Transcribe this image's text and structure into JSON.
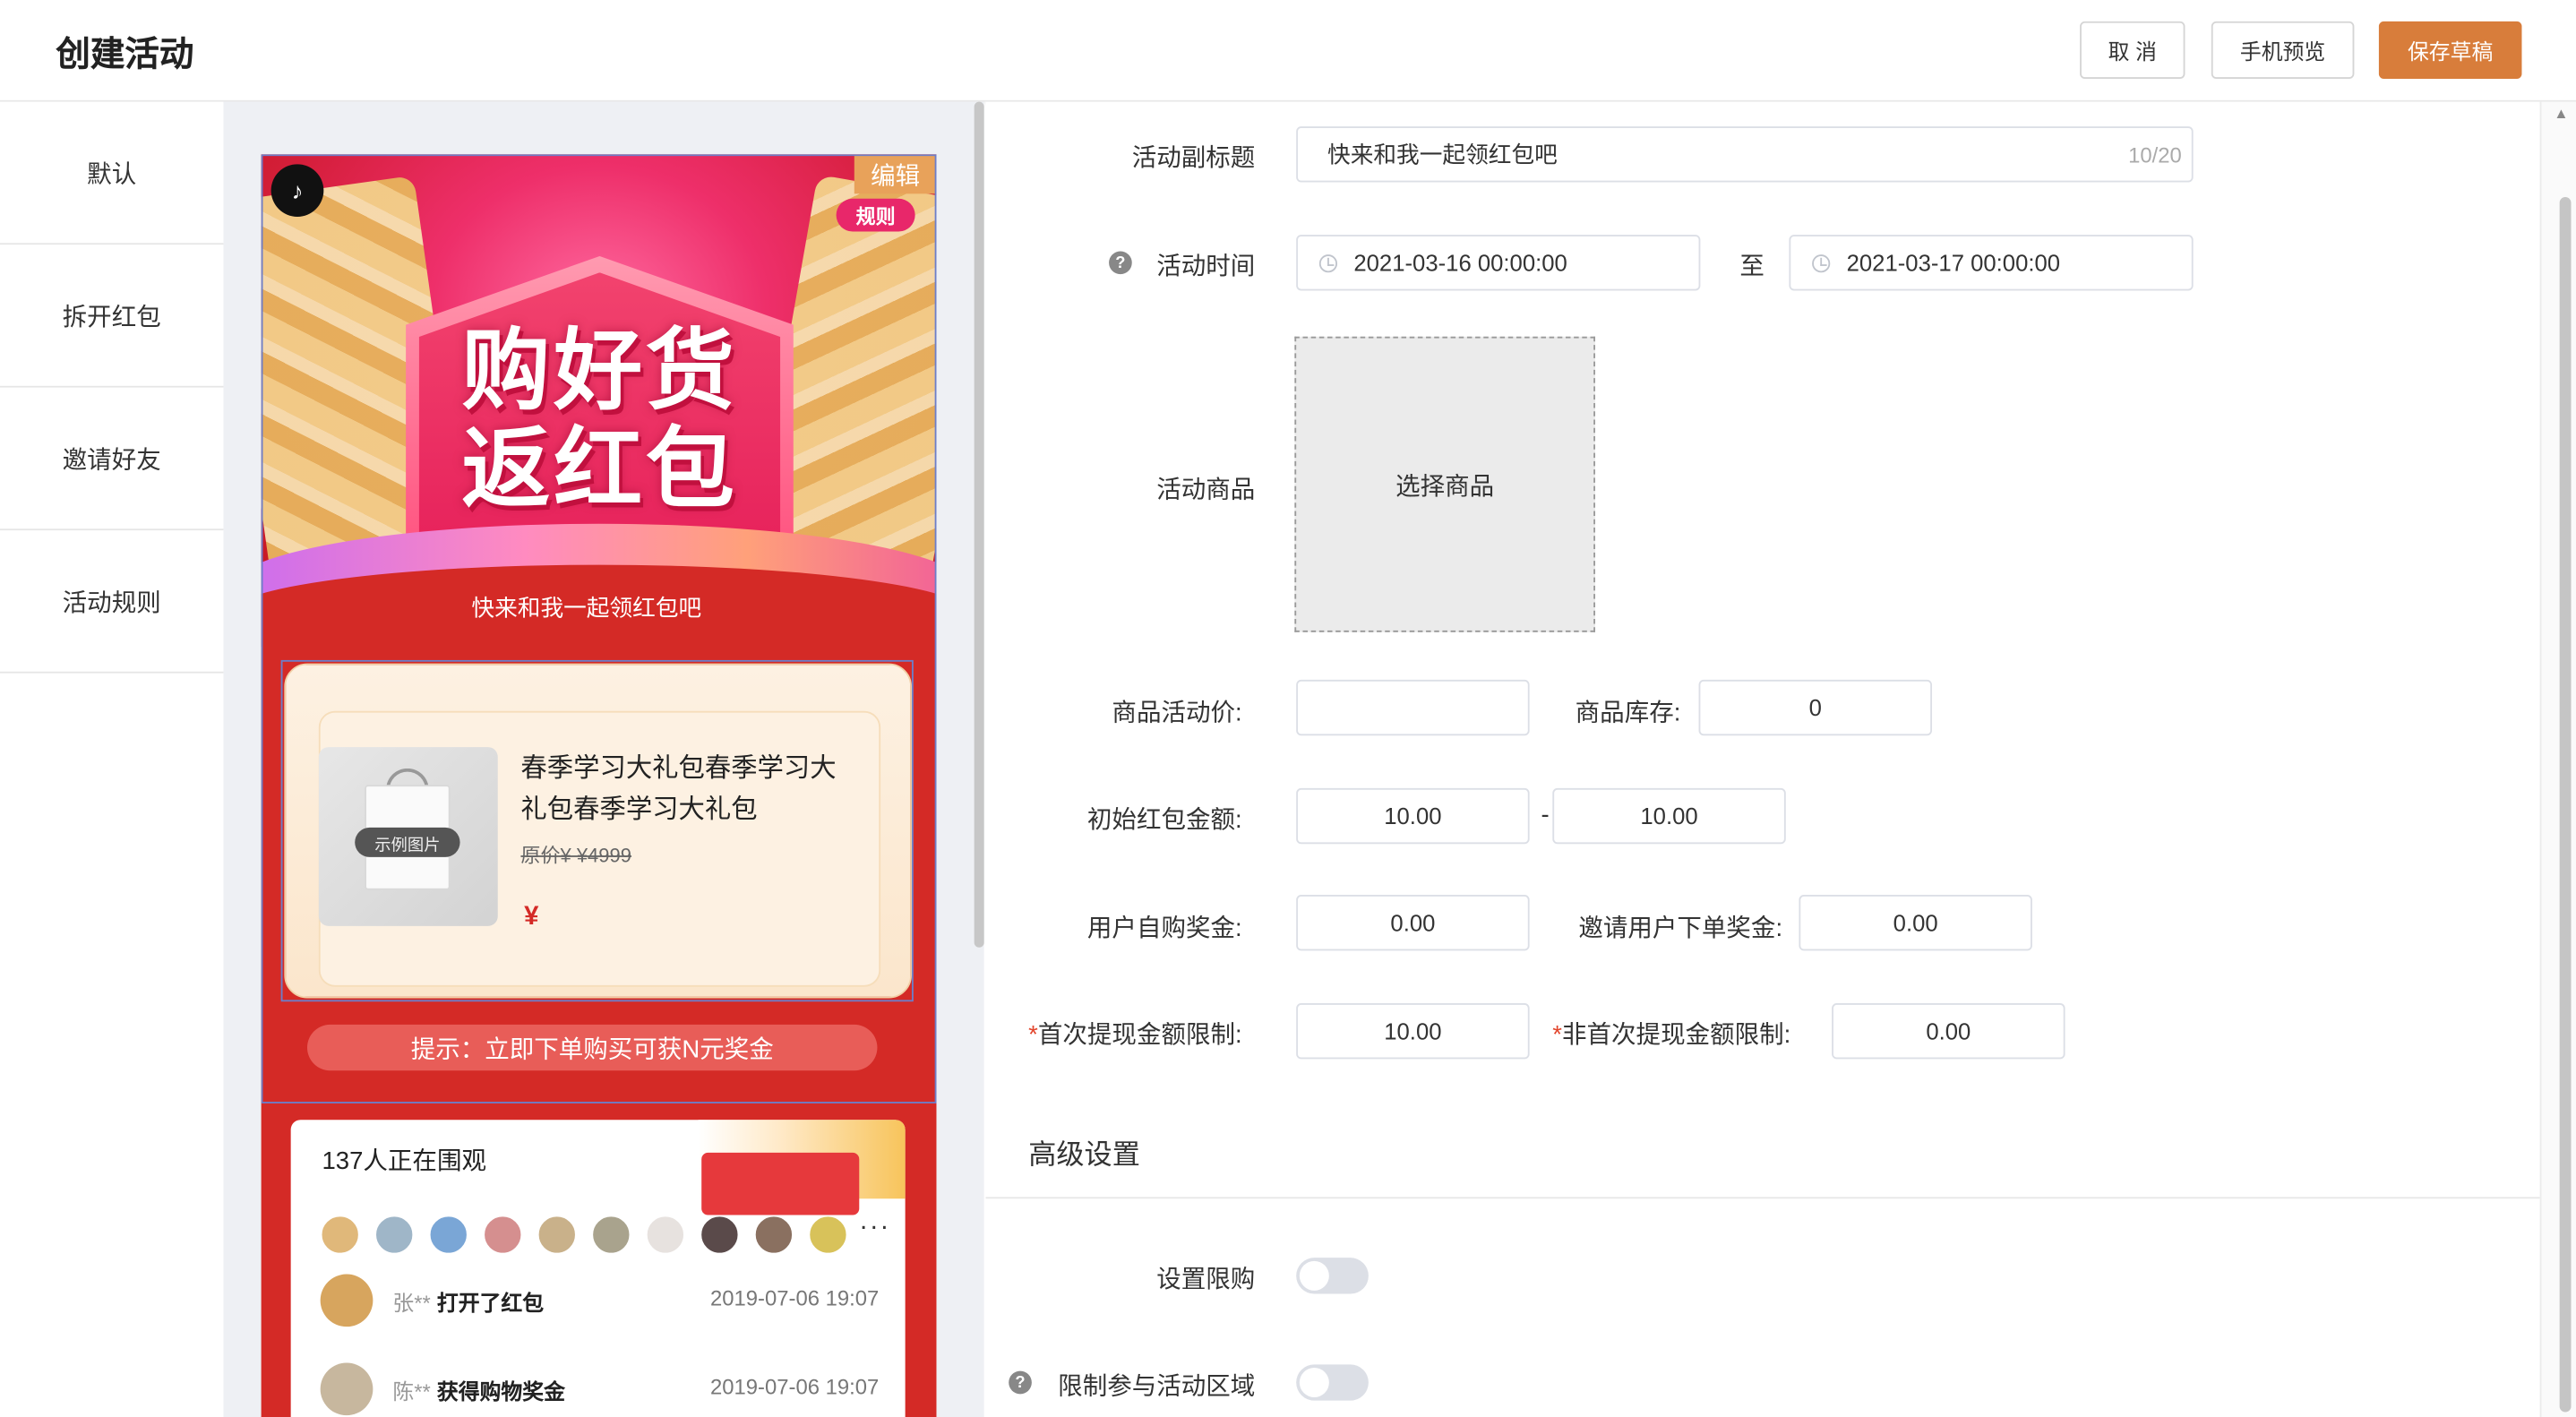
{
  "header": {
    "title": "创建活动",
    "cancel_label": "取 消",
    "preview_label": "手机预览",
    "save_label": "保存草稿"
  },
  "sidebar": {
    "items": [
      {
        "label": "默认"
      },
      {
        "label": "拆开红包"
      },
      {
        "label": "邀请好友"
      },
      {
        "label": "活动规则"
      }
    ]
  },
  "preview": {
    "edit_tag": "编辑",
    "rule_tag": "规则",
    "banner_line1": "购好货",
    "banner_line2": "返红包",
    "subtitle": "快来和我一起领红包吧",
    "product": {
      "name": "春季学习大礼包春季学习大礼包春季学习大礼包",
      "image_label": "示例图片",
      "original_price": "原价¥ ¥4999",
      "price_symbol": "¥"
    },
    "tip": "提示：立即下单购买可获N元奖金",
    "watching": "137人正在围观",
    "activities": [
      {
        "name": "张**",
        "action": "打开了红包",
        "time": "2019-07-06 19:07"
      },
      {
        "name": "陈**",
        "action": "获得购物奖金",
        "time": "2019-07-06 19:07"
      }
    ]
  },
  "form": {
    "subtitle_label": "活动副标题",
    "subtitle_value": "快来和我一起领红包吧",
    "subtitle_count": "10/20",
    "time_label": "活动时间",
    "start_time": "2021-03-16 00:00:00",
    "to_label": "至",
    "end_time": "2021-03-17 00:00:00",
    "goods_label": "活动商品",
    "choose_goods": "选择商品",
    "price_label": "商品活动价:",
    "price_value": "",
    "stock_label": "商品库存:",
    "stock_value": "0",
    "redpack_label": "初始红包金额:",
    "redpack_min": "10.00",
    "range_sep": "-",
    "redpack_max": "10.00",
    "self_bonus_label": "用户自购奖金:",
    "self_bonus_value": "0.00",
    "invite_bonus_label": "邀请用户下单奖金:",
    "invite_bonus_value": "0.00",
    "first_withdraw_label": "首次提现金额限制:",
    "first_withdraw_value": "10.00",
    "nonfirst_withdraw_label": "非首次提现金额限制:",
    "nonfirst_withdraw_value": "0.00",
    "advanced_title": "高级设置",
    "limit_buy_label": "设置限购",
    "limit_buy_on": false,
    "limit_area_label": "限制参与活动区域",
    "limit_area_on": false
  },
  "colors": {
    "primary": "#d87d3b",
    "banner_red": "#d42a26",
    "required": "#e2452c"
  }
}
